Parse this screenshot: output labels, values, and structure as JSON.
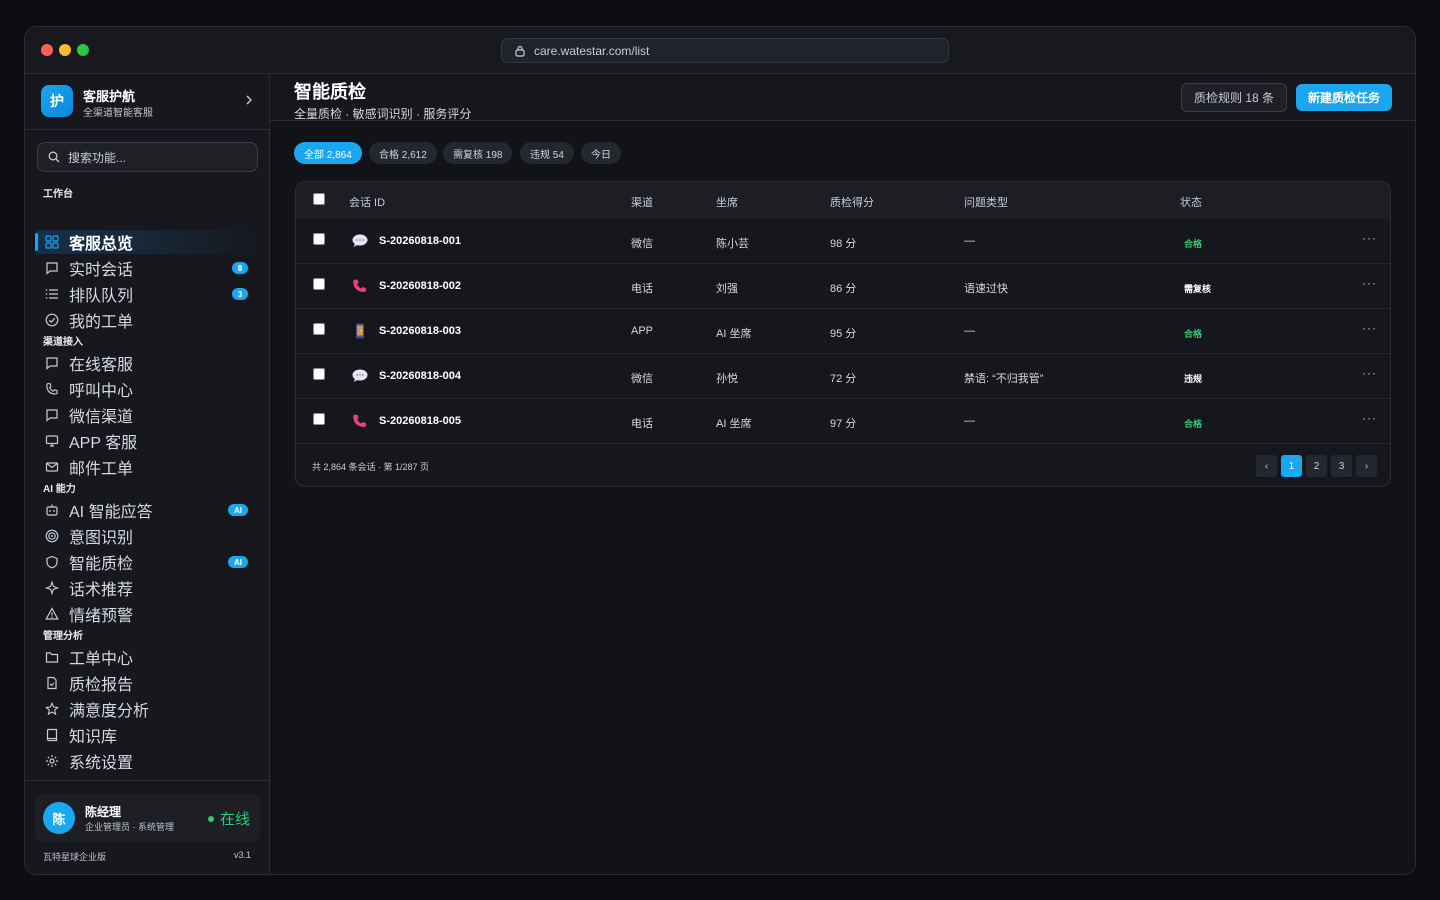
{
  "browser": {
    "url": "care.watestar.com/list"
  },
  "brand": {
    "logo_char": "护",
    "name": "客服护航",
    "subtitle": "全渠道智能客服"
  },
  "search": {
    "placeholder": "搜索功能..."
  },
  "sections": {
    "workbench": "工作台",
    "channels": "渠道接入",
    "ai": "AI 能力",
    "analysis": "管理分析"
  },
  "nav": {
    "overview": "客服总览",
    "live_chat": "实时会话",
    "live_chat_badge": "8",
    "queue": "排队队列",
    "queue_badge": "3",
    "my_tickets": "我的工单",
    "online_service": "在线客服",
    "call_center": "呼叫中心",
    "wechat_channel": "微信渠道",
    "app_service": "APP 客服",
    "email_ticket": "邮件工单",
    "ai_answer": "AI 智能应答",
    "ai_answer_badge": "AI",
    "intent": "意图识别",
    "quality": "智能质检",
    "quality_badge": "AI",
    "script_rec": "话术推荐",
    "emotion_alert": "情绪预警",
    "ticket_center": "工单中心",
    "qc_report": "质检报告",
    "satisfaction": "满意度分析",
    "knowledge": "知识库",
    "settings": "系统设置"
  },
  "user": {
    "avatar": "陈",
    "name": "陈经理",
    "role": "企业管理员 · 系统管理",
    "status": "在线"
  },
  "footer": {
    "edition": "瓦特星球企业版",
    "version": "v3.1"
  },
  "header": {
    "title": "智能质检",
    "subtitle": "全量质检 · 敏感词识别 · 服务评分",
    "rules_button": "质检规则 18 条",
    "new_button": "新建质检任务"
  },
  "filters": [
    "全部 2,864",
    "合格 2,612",
    "需复核 198",
    "违规 54",
    "今日"
  ],
  "table": {
    "columns": [
      "会话 ID",
      "渠道",
      "坐席",
      "质检得分",
      "问题类型",
      "状态"
    ],
    "rows": [
      {
        "id": "S-20260818-001",
        "channel": "微信",
        "agent": "陈小芸",
        "score": "98 分",
        "issue": "—",
        "status": "合格",
        "icon": "chat-bubble-icon"
      },
      {
        "id": "S-20260818-002",
        "channel": "电话",
        "agent": "刘强",
        "score": "86 分",
        "issue": "语速过快",
        "status": "需复核",
        "icon": "phone-icon"
      },
      {
        "id": "S-20260818-003",
        "channel": "APP",
        "agent": "AI 坐席",
        "score": "95 分",
        "issue": "—",
        "status": "合格",
        "icon": "mobile-icon"
      },
      {
        "id": "S-20260818-004",
        "channel": "微信",
        "agent": "孙悦",
        "score": "72 分",
        "issue": "禁语: “不归我管”",
        "status": "违规",
        "icon": "chat-bubble-icon"
      },
      {
        "id": "S-20260818-005",
        "channel": "电话",
        "agent": "AI 坐席",
        "score": "97 分",
        "issue": "—",
        "status": "合格",
        "icon": "phone-icon"
      }
    ],
    "footer_info": "共 2,864 条会话 · 第 1/287 页",
    "pagination": {
      "prev": "‹",
      "pages": [
        "1",
        "2",
        "3"
      ],
      "next": "›"
    },
    "more_label": "···"
  },
  "colors": {
    "accent": "#1aa7f0",
    "pass": "#2ecc71",
    "bg": "#121317"
  }
}
